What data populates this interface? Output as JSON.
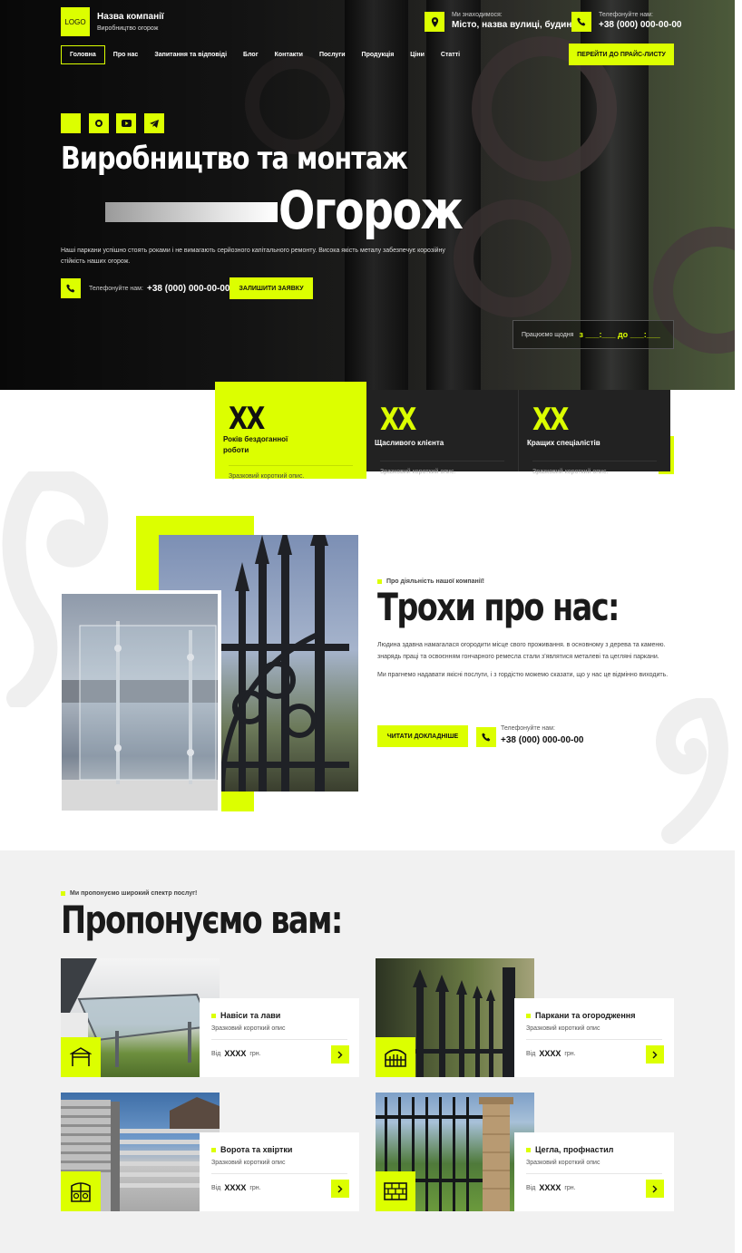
{
  "header": {
    "logo": "LOGO",
    "company_name": "Назва компанії",
    "company_tagline": "Виробництво огорож",
    "location_label": "Ми знаходимося:",
    "location_value": "Місто, назва вулиці, будинок",
    "phone_label": "Телефонуйте нам:",
    "phone_value": "+38 (000) 000-00-00",
    "price_button": "ПЕРЕЙТИ ДО ПРАЙС-ЛИСТУ",
    "nav": [
      "Головна",
      "Про нас",
      "Запитання та відповіді",
      "Блог",
      "Контакти",
      "Послуги",
      "Продукція",
      "Ціни",
      "Статті"
    ]
  },
  "hero": {
    "title_line1": "Виробництво та монтаж",
    "title_line2": "Огорож",
    "text": "Наші паркани успішно стоять роками і не вимагають серйозного капітального ремонту. Висока якість металу забезпечує корозійну стійкість наших огорож.",
    "phone_label": "Телефонуйте нам:",
    "phone_value": "+38 (000) 000-00-00",
    "apply_button": "ЗАЛИШИТИ ЗАЯВКУ",
    "hours_label": "Працюємо щодня",
    "hours_value": "з ___:___ до ___:___",
    "social_icons": [
      "square-icon",
      "whatsapp-icon",
      "youtube-icon",
      "telegram-icon"
    ]
  },
  "stats": [
    {
      "num": "XX",
      "label": "Років бездоганної роботи",
      "desc": "Зразковий короткий опис."
    },
    {
      "num": "XX",
      "label": "Щасливого клієнта",
      "desc": "Зразковий короткий опис."
    },
    {
      "num": "XX",
      "label": "Кращих спеціалістів",
      "desc": "Зразковий короткий опис."
    }
  ],
  "about": {
    "eyebrow": "Про діяльність нашої компанії!",
    "title": "Трохи про нас:",
    "p1": "Людина здавна намагалася огородити місце свого проживання. в основному з дерева та каменю. знарядь праці та освоєнням гончарного ремесла стали з'являтися металеві та цегляні паркани.",
    "p2": "Ми прагнемо надавати якісні послуги, і з гордістю можемо сказати, що у нас це відмінно виходить.",
    "read_button": "ЧИТАТИ ДОКЛАДНІШЕ",
    "phone_label": "Телефонуйте нам:",
    "phone_value": "+38 (000) 000-00-00"
  },
  "services": {
    "eyebrow": "Ми пропонуємо широкий спектр послуг!",
    "title": "Пропонуємо вам:",
    "items": [
      {
        "title": "Навіси та лави",
        "desc": "Зразковий короткий опис",
        "from": "Від",
        "price": "XXXX",
        "unit": "грн.",
        "icon": "gazebo-icon"
      },
      {
        "title": "Паркани та огородження",
        "desc": "Зразковий короткий опис",
        "from": "Від",
        "price": "XXXX",
        "unit": "грн.",
        "icon": "fence-icon"
      },
      {
        "title": "Ворота та хвіртки",
        "desc": "Зразковий короткий опис",
        "from": "Від",
        "price": "XXXX",
        "unit": "грн.",
        "icon": "gate-icon"
      },
      {
        "title": "Цегла, профнастил",
        "desc": "Зразковий короткий опис",
        "from": "Від",
        "price": "XXXX",
        "unit": "грн.",
        "icon": "brick-icon"
      }
    ]
  },
  "colors": {
    "accent": "#dcff00",
    "dark": "#222222",
    "light_bg": "#f1f1f1"
  }
}
